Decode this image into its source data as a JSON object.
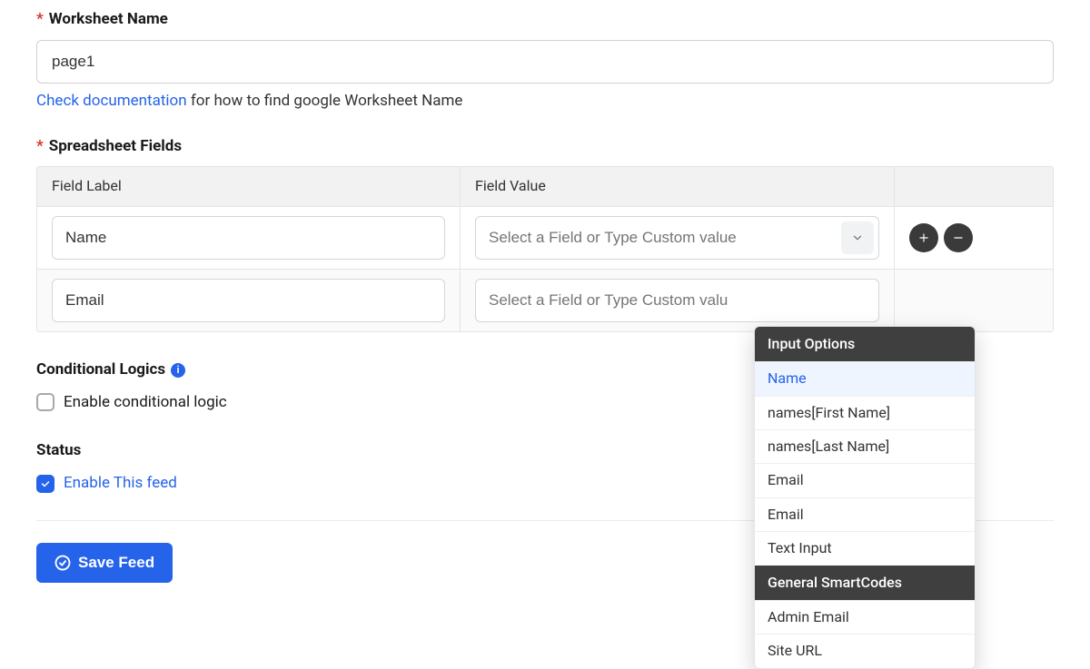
{
  "worksheet": {
    "label": "Worksheet Name",
    "value": "page1",
    "hint_link": "Check documentation",
    "hint_rest": " for how to find google Worksheet Name"
  },
  "spreadsheet": {
    "label": "Spreadsheet Fields",
    "headers": {
      "label": "Field Label",
      "value": "Field Value"
    },
    "rows": [
      {
        "label": "Name",
        "value_placeholder": "Select a Field or Type Custom value"
      },
      {
        "label": "Email",
        "value_placeholder": "Select a Field or Type Custom valu"
      }
    ]
  },
  "dropdown": {
    "groups": [
      {
        "header": "Input Options",
        "items": [
          {
            "label": "Name",
            "highlight": true
          },
          {
            "label": "names[First Name]"
          },
          {
            "label": "names[Last Name]"
          },
          {
            "label": "Email"
          },
          {
            "label": "Email"
          },
          {
            "label": "Text Input"
          }
        ]
      },
      {
        "header": "General SmartCodes",
        "items": [
          {
            "label": "Admin Email"
          },
          {
            "label": "Site URL"
          }
        ]
      }
    ]
  },
  "conditional": {
    "heading": "Conditional Logics",
    "checkbox_label": "Enable conditional logic",
    "checked": false
  },
  "status": {
    "heading": "Status",
    "checkbox_label": "Enable This feed",
    "checked": true
  },
  "save_button": "Save Feed"
}
